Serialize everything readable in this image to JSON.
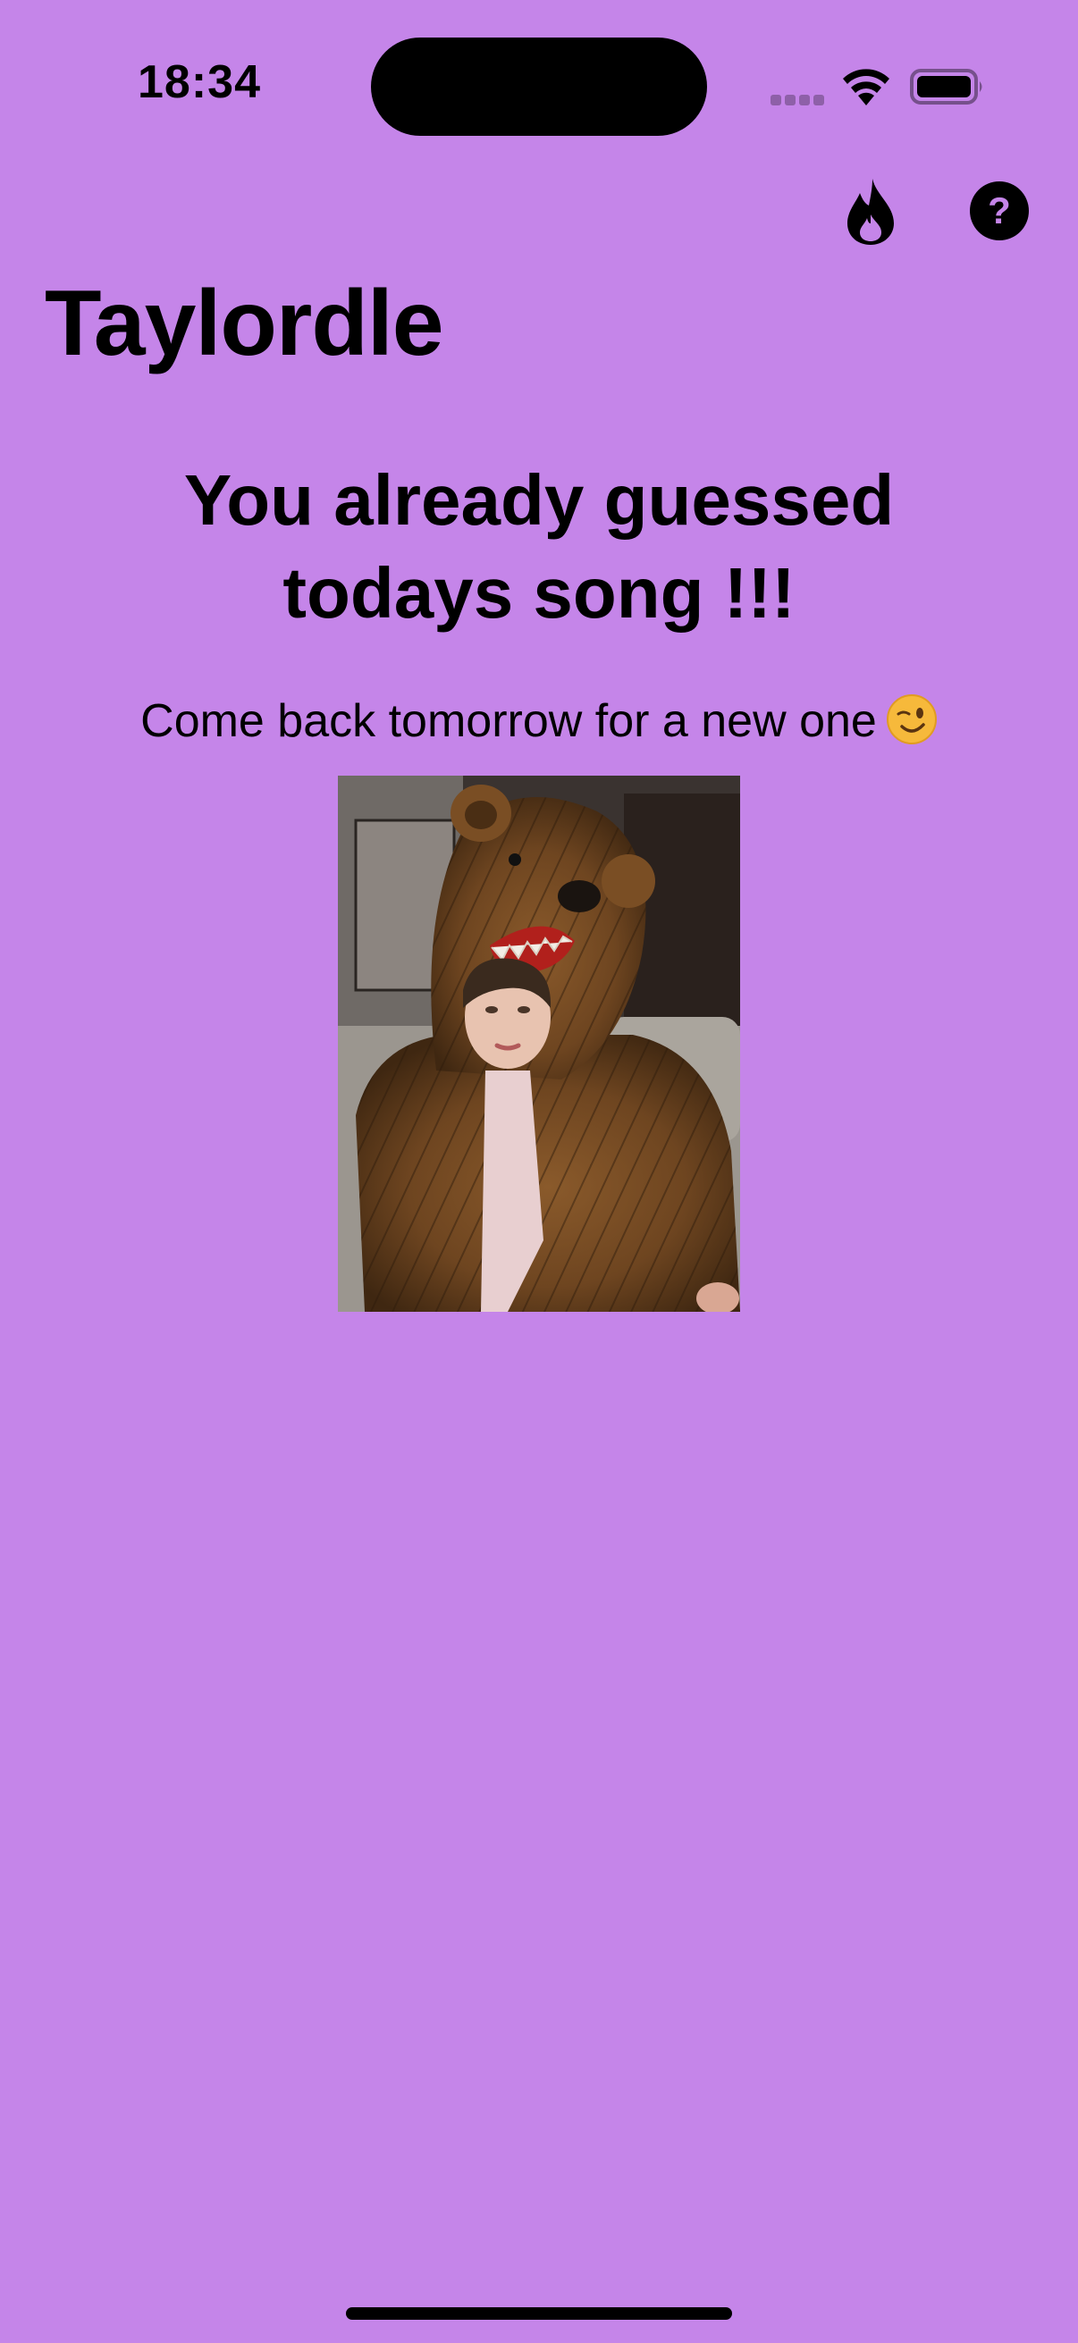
{
  "status_bar": {
    "time": "18:34"
  },
  "icons": {
    "streak": "flame-icon",
    "help": "question-mark-icon",
    "help_glyph": "?",
    "emoji": "winking-face-emoji"
  },
  "header": {
    "title": "Taylordle"
  },
  "main": {
    "headline": "You already guessed todays song !!!",
    "subtext": "Come back tomorrow for a new one"
  },
  "colors": {
    "background": "#c585e9",
    "text": "#000000"
  }
}
